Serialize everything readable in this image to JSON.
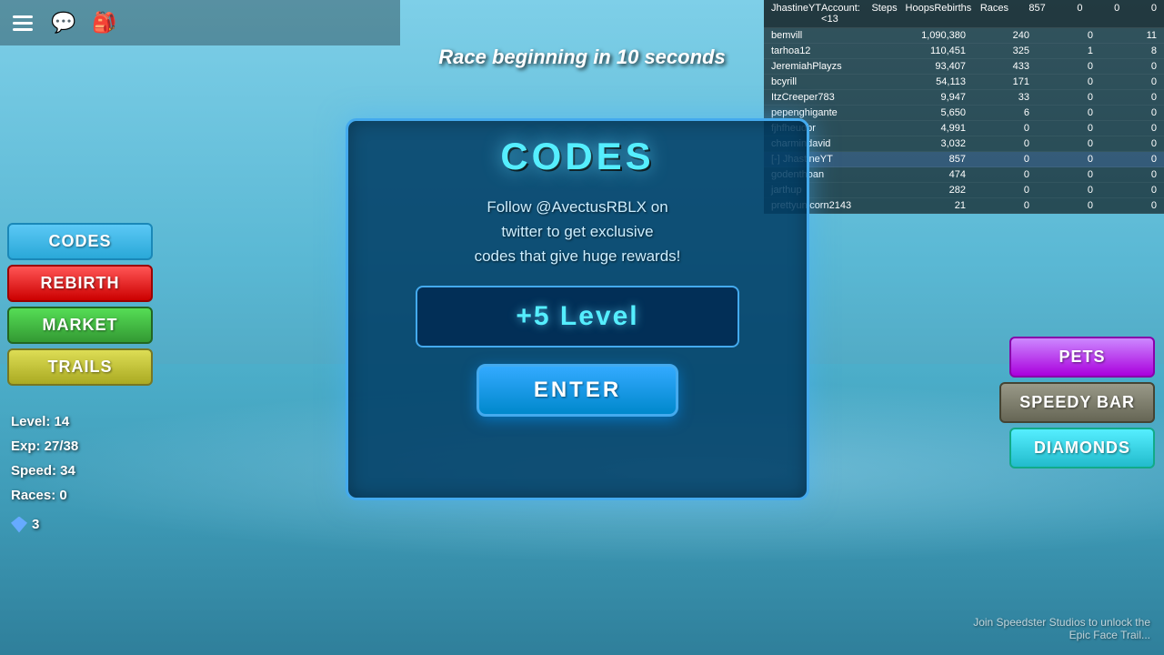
{
  "background": {
    "color": "#5ab8d4"
  },
  "top_bar": {
    "icons": [
      "☰",
      "💬",
      "🎒"
    ]
  },
  "race_timer": {
    "text": "Race beginning in 10 seconds"
  },
  "leaderboard": {
    "header": {
      "username": "JhastineYT",
      "account": "Account: <13",
      "steps_label": "Steps",
      "hoops_label": "Hoops",
      "rebirths_label": "Rebirths",
      "races_label": "Races",
      "steps_val": "857",
      "hoops_val": "0",
      "rebirths_val": "0",
      "races_val": "0"
    },
    "rows": [
      {
        "name": "bemvill",
        "steps": "1,090,380",
        "hoops": "240",
        "rebirths": "0",
        "races": "11",
        "highlight": false
      },
      {
        "name": "tarhoa12",
        "steps": "110,451",
        "hoops": "325",
        "rebirths": "1",
        "races": "8",
        "highlight": false
      },
      {
        "name": "JeremiahPlayzs",
        "steps": "93,407",
        "hoops": "433",
        "rebirths": "0",
        "races": "0",
        "highlight": false
      },
      {
        "name": "bcyrill",
        "steps": "54,113",
        "hoops": "171",
        "rebirths": "0",
        "races": "0",
        "highlight": false
      },
      {
        "name": "ItzCreeper783",
        "steps": "9,947",
        "hoops": "33",
        "rebirths": "0",
        "races": "0",
        "highlight": false
      },
      {
        "name": "pepenghigante",
        "steps": "5,650",
        "hoops": "6",
        "rebirths": "0",
        "races": "0",
        "highlight": false
      },
      {
        "name": "fjhfheudbr",
        "steps": "4,991",
        "hoops": "0",
        "rebirths": "0",
        "races": "0",
        "highlight": false
      },
      {
        "name": "charmindavid",
        "steps": "3,032",
        "hoops": "0",
        "rebirths": "0",
        "races": "0",
        "highlight": false
      },
      {
        "name": "[-] JhastineYT",
        "steps": "857",
        "hoops": "0",
        "rebirths": "0",
        "races": "0",
        "highlight": true
      },
      {
        "name": "godenthoan",
        "steps": "474",
        "hoops": "0",
        "rebirths": "0",
        "races": "0",
        "highlight": false
      },
      {
        "name": "jarthup",
        "steps": "282",
        "hoops": "0",
        "rebirths": "0",
        "races": "0",
        "highlight": false
      },
      {
        "name": "prettyunicorn2143",
        "steps": "21",
        "hoops": "0",
        "rebirths": "0",
        "races": "0",
        "highlight": false
      }
    ]
  },
  "left_sidebar": {
    "codes_label": "CODES",
    "rebirth_label": "REBIRTH",
    "market_label": "MARKET",
    "trails_label": "TRAILS"
  },
  "stats": {
    "level_label": "Level: 14",
    "exp_label": "Exp: 27/38",
    "speed_label": "Speed: 34",
    "races_label": "Races: 0",
    "diamonds_count": "3"
  },
  "modal": {
    "title": "CODES",
    "description": "Follow @AvectusRBLX on\ntwitter to get exclusive\ncodes that give huge rewards!",
    "reward": "+5 Level",
    "enter_label": "ENTER"
  },
  "right_sidebar": {
    "pets_label": "PETS",
    "speedy_label": "SPEEDY BAR",
    "diamonds_label": "DIAMONDS"
  },
  "bottom_right": {
    "line1": "Join Speedster Studios to unlock the",
    "line2": "Epic Face Trail..."
  }
}
